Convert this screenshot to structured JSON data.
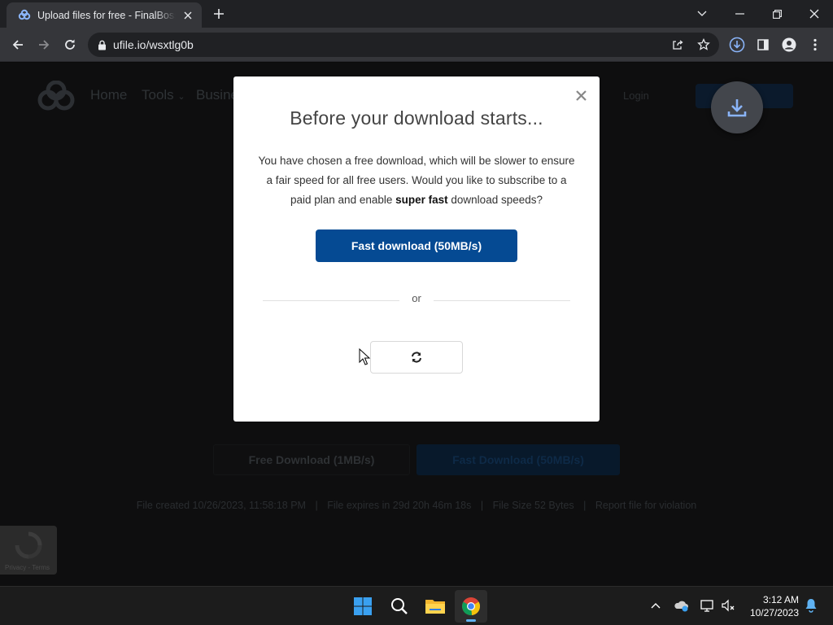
{
  "browser": {
    "tab_title": "Upload files for free - FinalBoss.b",
    "url": "ufile.io/wsxtlg0b"
  },
  "site": {
    "nav": {
      "home": "Home",
      "tools": "Tools",
      "business": "Busine",
      "login": "Login"
    },
    "free_download_label": "Free Download (1MB/s)",
    "fast_download_label": "Fast Download (50MB/s)",
    "file_meta": {
      "created": "File created  10/26/2023, 11:58:18 PM",
      "expires": "File expires in  29d 20h 46m 18s",
      "size": "File Size  52 Bytes",
      "report": "Report file for violation",
      "separator": "|"
    },
    "recaptcha_text": "Privacy - Terms"
  },
  "modal": {
    "title": "Before your download starts...",
    "body_part1": "You have chosen a free download, which will be slower to ensure a fair speed for all free users. Would you like to subscribe to a paid plan and enable ",
    "body_bold": "super fast",
    "body_part2": " download speeds?",
    "fast_button": "Fast download (50MB/s)",
    "or_label": "or",
    "close_glyph": "×"
  },
  "taskbar": {
    "time": "3:12 AM",
    "date": "10/27/2023"
  },
  "colors": {
    "modal_button": "#054a93",
    "page_overlay": "#0e0e0f",
    "taskbar": "#1c1c1c"
  }
}
